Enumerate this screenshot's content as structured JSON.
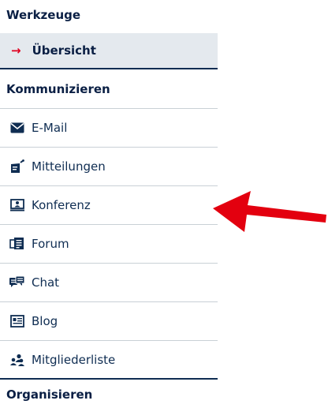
{
  "sidebar": {
    "tools_title": "Werkzeuge",
    "active_item": {
      "arrow_icon": "arrow-right-icon",
      "label": "Übersicht"
    },
    "communicate_title": "Kommunizieren",
    "items": [
      {
        "label": "E-Mail",
        "icon": "envelope-icon"
      },
      {
        "label": "Mitteilungen",
        "icon": "notice-board-icon"
      },
      {
        "label": "Konferenz",
        "icon": "presentation-board-icon"
      },
      {
        "label": "Forum",
        "icon": "forum-icon"
      },
      {
        "label": "Chat",
        "icon": "chat-icon"
      },
      {
        "label": "Blog",
        "icon": "blog-icon"
      },
      {
        "label": "Mitgliederliste",
        "icon": "members-icon"
      }
    ],
    "organize_title": "Organisieren"
  },
  "annotation": {
    "arrow_color": "#e3000f"
  },
  "colors": {
    "accent": "#0f2d52",
    "active_background": "#e4e9ee",
    "active_arrow": "#e0001f"
  }
}
